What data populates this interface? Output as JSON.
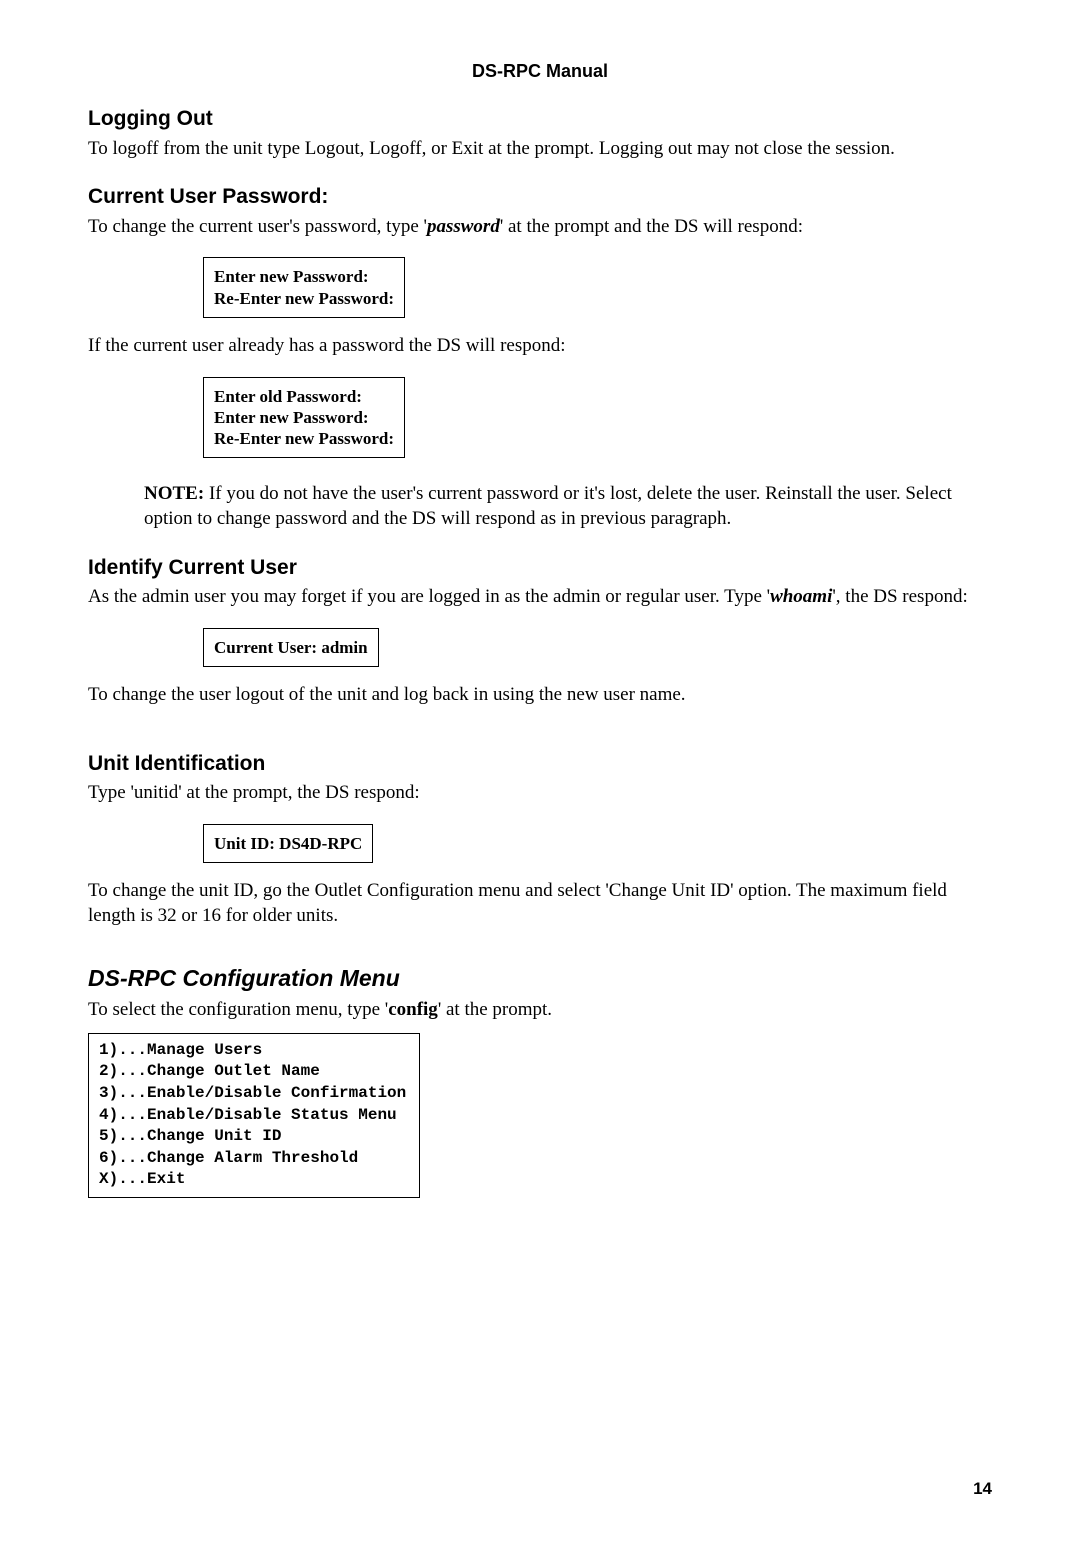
{
  "header": "DS-RPC Manual",
  "s1": {
    "heading": "Logging Out",
    "body": "To logoff from the unit type Logout, Logoff, or Exit at the prompt. Logging out may not close the session."
  },
  "s2": {
    "heading": "Current User Password:",
    "intro_a": "To change the current user's password, type '",
    "intro_cmd": "password",
    "intro_b": "' at the prompt and the DS will respond:",
    "box1": "Enter new Password:\nRe-Enter new Password:",
    "mid": "If the current user already has a password the DS will respond:",
    "box2": "Enter old Password:\nEnter new Password:\nRe-Enter new Password:",
    "note_label": "NOTE:",
    "note_body": " If you do not have the user's current password or it's lost, delete the user. Reinstall the user. Select option to change password and the DS will respond as in previous paragraph."
  },
  "s3": {
    "heading": "Identify Current User",
    "intro_a": "As the admin user you may forget if you are logged in as the admin or regular user. Type '",
    "intro_cmd": "whoami",
    "intro_b": "', the DS respond:",
    "box": "Current User: admin",
    "after": "To change the user logout of the unit and log back in using the new user name."
  },
  "s4": {
    "heading": "Unit Identification",
    "intro": "Type 'unitid' at the prompt, the DS respond:",
    "box": "Unit ID: DS4D-RPC",
    "after": "To change the unit ID, go the Outlet Configuration menu and select 'Change Unit ID' option. The maximum field length is 32 or 16 for older units."
  },
  "s5": {
    "heading": "DS-RPC Configuration Menu",
    "intro_a": "To select the configuration menu, type '",
    "intro_cmd": "config",
    "intro_b": "' at the prompt.",
    "menu": "1)...Manage Users\n2)...Change Outlet Name\n3)...Enable/Disable Confirmation\n4)...Enable/Disable Status Menu\n5)...Change Unit ID\n6)...Change Alarm Threshold\nX)...Exit"
  },
  "page_number": "14"
}
